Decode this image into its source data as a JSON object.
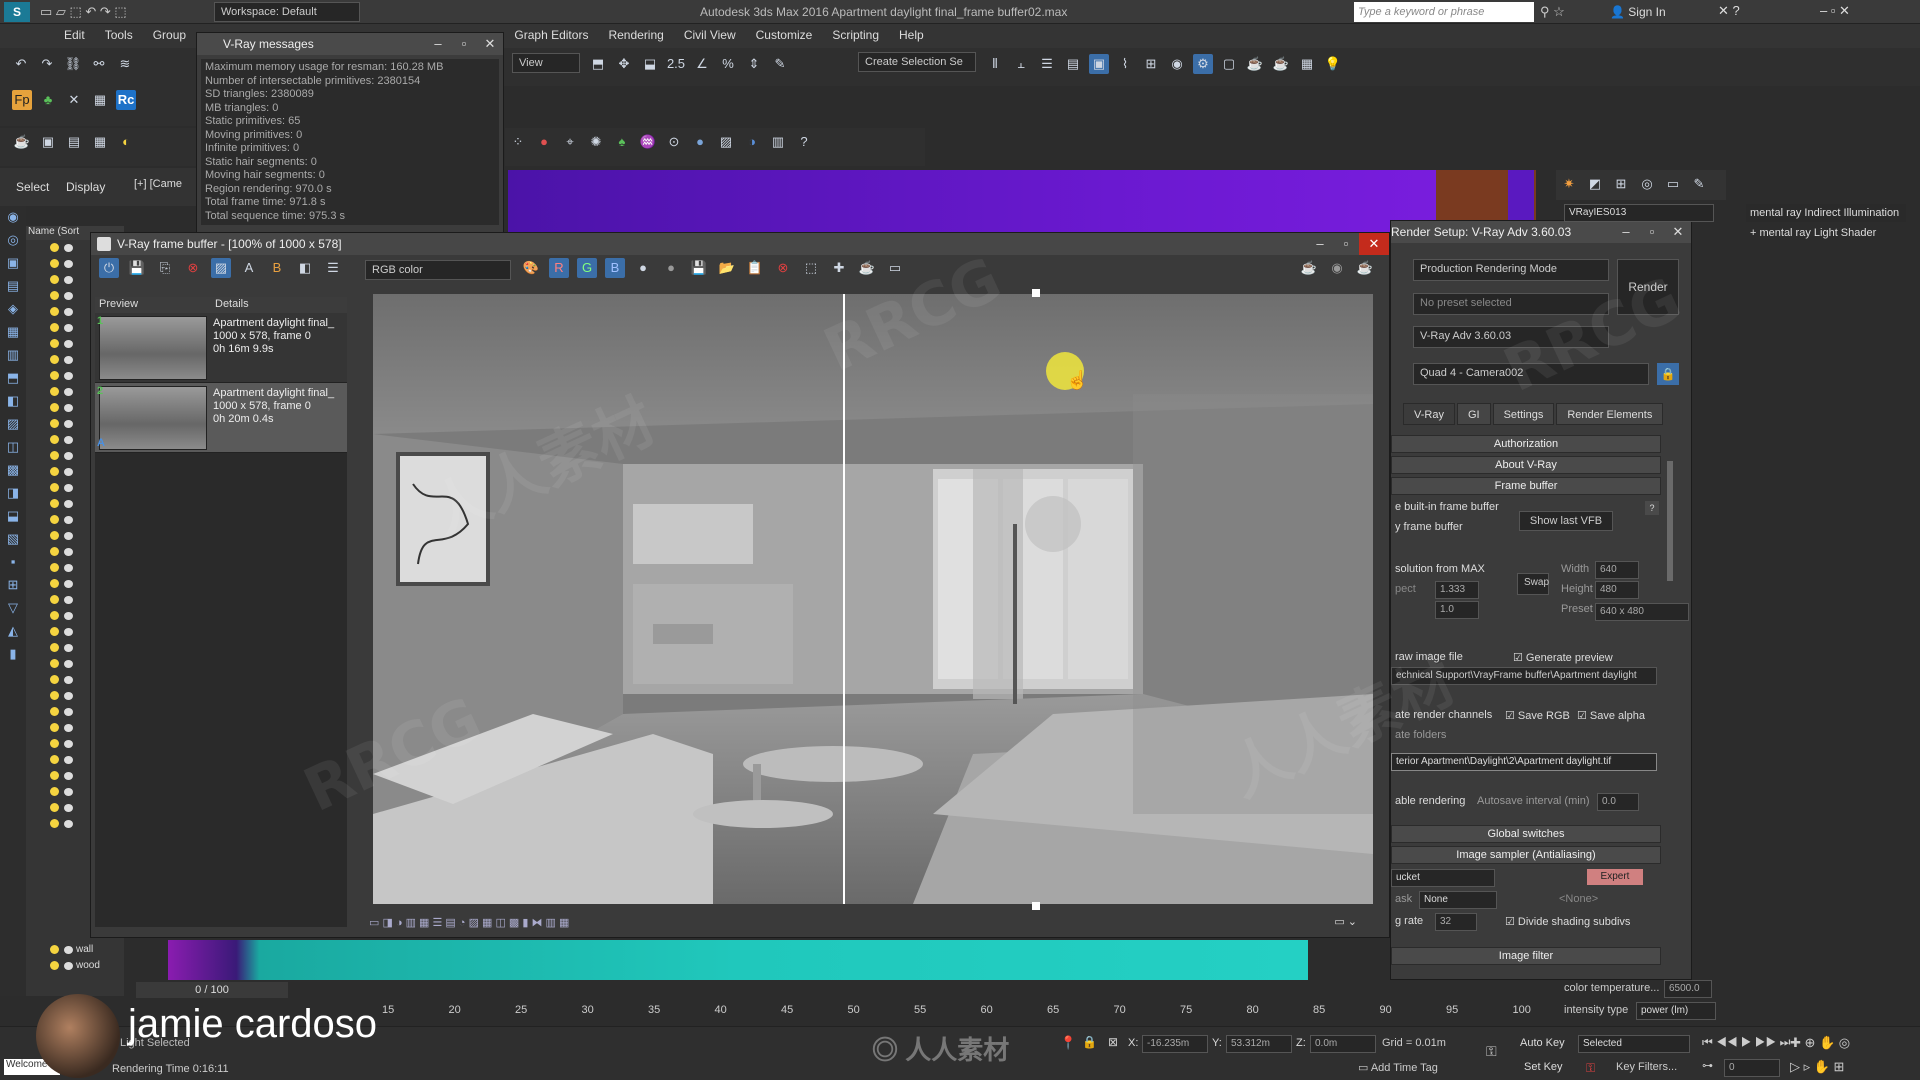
{
  "app": {
    "title": "Autodesk 3ds Max 2016    Apartment daylight final_frame buffer02.max",
    "workspace": "Workspace: Default",
    "search_placeholder": "Type a keyword or phrase",
    "sign_in": "Sign In",
    "menu": [
      "Edit",
      "Tools",
      "Group",
      "Views",
      "Create",
      "Modifiers",
      "Animation",
      "Graph Editors",
      "Rendering",
      "Civil View",
      "Customize",
      "Scripting",
      "Help"
    ],
    "view_dropdown": "View",
    "selection_set": "Create Selection Se",
    "viewport_label": "[+] [Came",
    "select_tab": "Select",
    "display_tab": "Display",
    "scene_header": "Name (Sort"
  },
  "vray_messages": {
    "title": "V-Ray messages",
    "lines": [
      "Maximum memory usage for resman: 160.28 MB",
      "Number of intersectable primitives: 2380154",
      "SD triangles: 2380089",
      "MB triangles: 0",
      "Static primitives: 65",
      "Moving primitives: 0",
      "Infinite primitives: 0",
      "Static hair segments: 0",
      "Moving hair segments: 0",
      "Region rendering: 970.0 s",
      "Total frame time: 971.8 s",
      "Total sequence time: 975.3 s"
    ]
  },
  "vfb": {
    "title": "V-Ray frame buffer - [100% of 1000 x 578]",
    "channel": "RGB color",
    "history_headers": {
      "preview": "Preview",
      "details": "Details"
    },
    "history": [
      {
        "index": "1",
        "name": "Apartment daylight final_",
        "size": "1000 x 578, frame 0",
        "time": "0h 16m 9.9s"
      },
      {
        "index": "2",
        "name": "Apartment daylight final_",
        "size": "1000 x 578, frame 0",
        "time": "0h 20m 0.4s"
      }
    ],
    "history_ab": "A"
  },
  "render_setup": {
    "title": "Render Setup: V-Ray Adv 3.60.03",
    "mode": "Production Rendering Mode",
    "preset": "No preset selected",
    "renderer": "V-Ray Adv 3.60.03",
    "view": "Quad 4 - Camera002",
    "render_button": "Render",
    "tabs": [
      "V-Ray",
      "GI",
      "Settings",
      "Render Elements"
    ],
    "rollouts": {
      "authorization": "Authorization",
      "about": "About V-Ray",
      "frame_buffer": "Frame buffer",
      "global_switches": "Global switches",
      "image_sampler": "Image sampler (Antialiasing)",
      "image_filter": "Image filter"
    },
    "builtin_fb": "e built-in frame buffer",
    "memory_fb": "y frame buffer",
    "show_last_vfb": "Show last VFB",
    "resolution_from_max": "solution from MAX",
    "aspect_label": "pect",
    "aspect_value": "1.333",
    "pixel_aspect_value": "1.0",
    "swap": "Swap",
    "width_label": "Width",
    "width_value": "640",
    "height_label": "Height",
    "height_value": "480",
    "preset_label": "Preset",
    "preset_value": "640 x 480",
    "raw_image": "raw image file",
    "generate_preview": "Generate preview",
    "raw_path": "echnical Support\\VrayFrame buffer\\Apartment daylight",
    "render_channels": "ate render channels",
    "save_rgb": "Save RGB",
    "save_alpha": "Save alpha",
    "folders": "ate folders",
    "out_path": "terior Apartment\\Daylight\\2\\Apartment daylight.tif",
    "autosave_label": "able rendering",
    "autosave_interval": "Autosave interval (min)",
    "autosave_value": "0.0",
    "bucket": "ucket",
    "expert": "Expert",
    "mask_label": "ask",
    "mask_value": "None",
    "none_ref": "<None>",
    "rate_label": "g rate",
    "rate_value": "32",
    "divide_shading": "Divide shading subdivs"
  },
  "right_panel": {
    "object_name": "VRayIES013",
    "item1": "mental ray Indirect Illumination",
    "item2": "mental ray Light Shader",
    "color_temp_label": "color temperature...",
    "color_temp_value": "6500.0",
    "intensity_label": "intensity type",
    "intensity_value": "power (lm)"
  },
  "scene_items": [
    "wall",
    "wood"
  ],
  "timeline": {
    "frame": "0 / 100",
    "ticks": [
      "15",
      "20",
      "25",
      "30",
      "35",
      "40",
      "45",
      "50",
      "55",
      "60",
      "65",
      "70",
      "75",
      "80",
      "85",
      "90",
      "95",
      "100"
    ]
  },
  "status": {
    "selected": "Light Selected",
    "welcome": "Welcome",
    "render_time": "Rendering Time  0:16:11",
    "x_label": "X:",
    "x_value": "-16.235m",
    "y_label": "Y:",
    "y_value": "53.312m",
    "z_label": "Z:",
    "z_value": "0.0m",
    "grid": "Grid = 0.01m",
    "auto_key": "Auto Key",
    "set_key": "Set Key",
    "selected_dropdown": "Selected",
    "key_filters": "Key Filters...",
    "add_time_tag": "Add Time Tag",
    "frame_value": "0"
  },
  "presenter": "jamie cardoso",
  "watermark": {
    "rrcg": "RRCG",
    "cn": "人人素材"
  }
}
